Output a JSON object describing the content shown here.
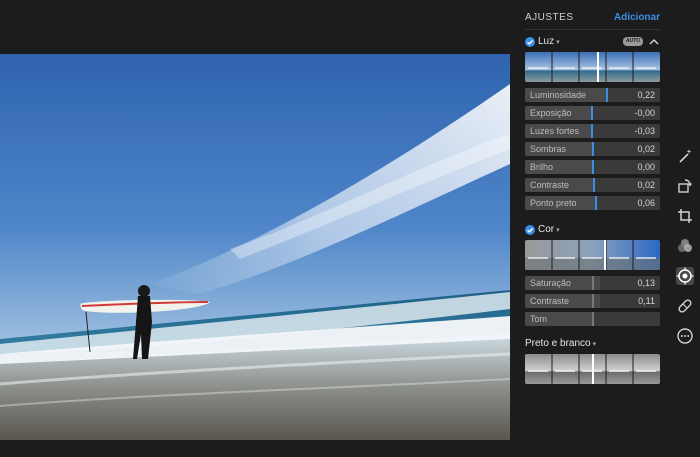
{
  "panel": {
    "title": "AJUSTES",
    "add_label": "Adicionar"
  },
  "luz": {
    "name": "Luz",
    "auto_label": "AUTO",
    "sliders": [
      {
        "label": "Luminosidade",
        "value": "0,22",
        "level": 0.22
      },
      {
        "label": "Exposição",
        "value": "-0,00",
        "level": 0.0
      },
      {
        "label": "Luzes fortes",
        "value": "-0,03",
        "level": -0.03
      },
      {
        "label": "Sombras",
        "value": "0,02",
        "level": 0.02
      },
      {
        "label": "Brilho",
        "value": "0,00",
        "level": 0.0
      },
      {
        "label": "Contraste",
        "value": "0,02",
        "level": 0.02
      },
      {
        "label": "Ponto preto",
        "value": "0,06",
        "level": 0.06
      }
    ]
  },
  "cor": {
    "name": "Cor",
    "sliders": [
      {
        "label": "Saturação",
        "value": "0,13",
        "level": 0.13
      },
      {
        "label": "Contraste",
        "value": "0,11",
        "level": 0.11
      },
      {
        "label": "Tom",
        "value": "",
        "level": 0.0
      }
    ]
  },
  "pb": {
    "name": "Preto e branco"
  },
  "colors": {
    "accent": "#3a8ee6",
    "panel_bg": "#1c1c1c",
    "slider_bg": "#3a3a3a"
  },
  "toolbar": [
    "magic-wand-icon",
    "rotate-icon",
    "crop-icon",
    "filters-icon",
    "adjust-icon",
    "retouch-icon",
    "more-icon"
  ]
}
